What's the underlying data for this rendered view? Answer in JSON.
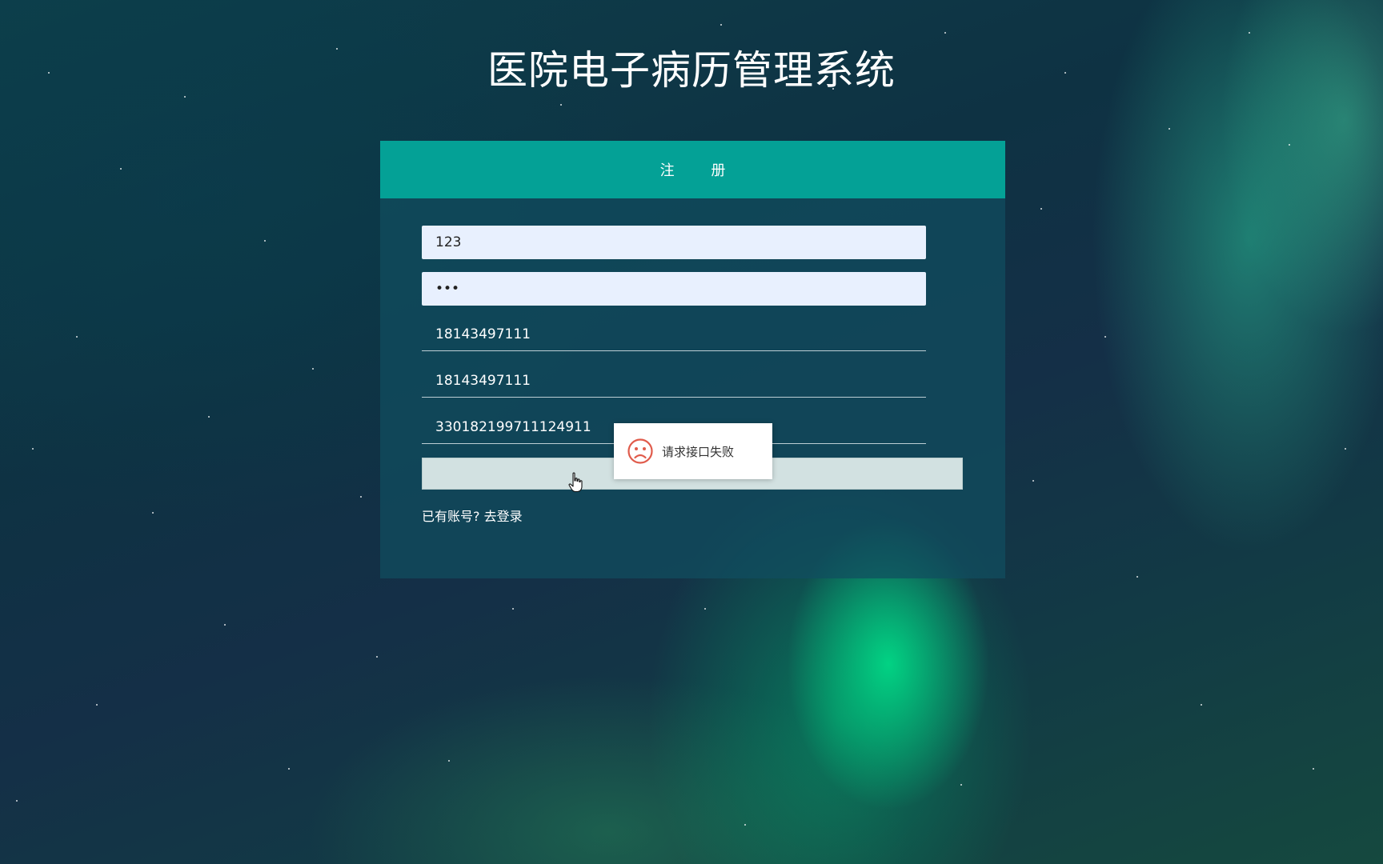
{
  "page": {
    "title": "医院电子病历管理系统"
  },
  "register_card": {
    "header": "注 册",
    "fields": {
      "username_value": "123",
      "password_value": "•••",
      "phone_value": "18143497111",
      "phone2_value": "18143497111",
      "id_number_value": "330182199711124911"
    },
    "submit_label": "",
    "have_account_text": "已有账号?",
    "login_link": "去登录"
  },
  "toast": {
    "icon": "sad-face-icon",
    "message": "请求接口失败"
  },
  "colors": {
    "header_bg": "#04a196",
    "toast_icon": "#e05b4b"
  }
}
